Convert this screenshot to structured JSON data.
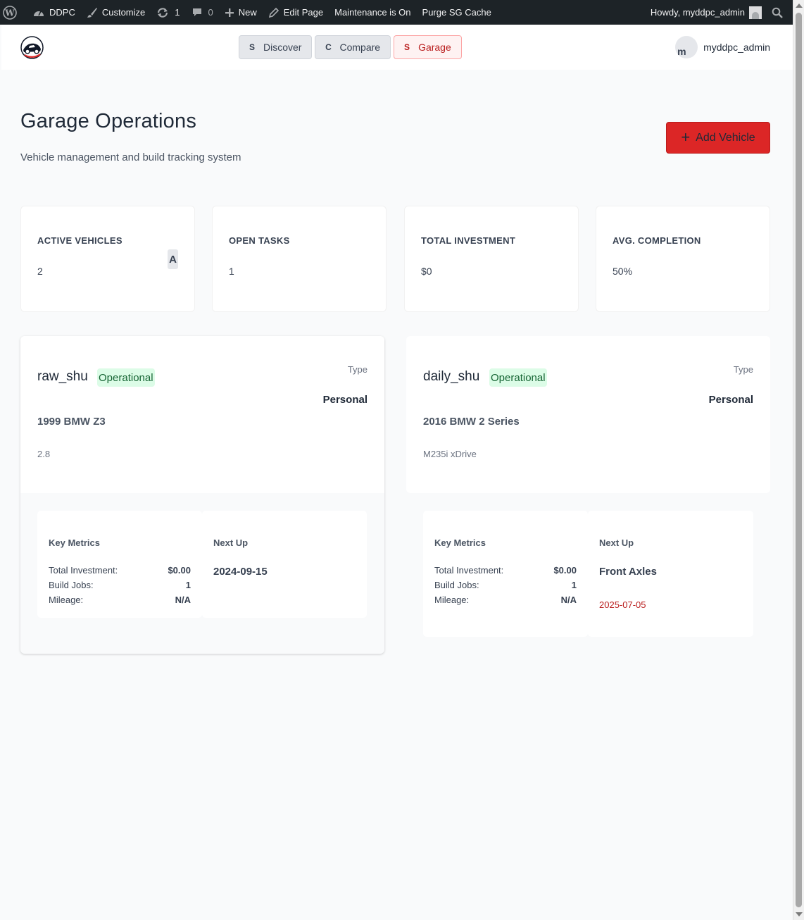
{
  "adminbar": {
    "site": "DDPC",
    "customize": "Customize",
    "updates_count": "1",
    "comments_count": "0",
    "new": "New",
    "edit_page": "Edit Page",
    "maintenance": "Maintenance is On",
    "purge": "Purge SG Cache",
    "howdy": "Howdy, myddpc_admin"
  },
  "nav": {
    "tabs": [
      {
        "badge": "S",
        "label": "Discover"
      },
      {
        "badge": "C",
        "label": "Compare"
      },
      {
        "badge": "S",
        "label": "Garage"
      }
    ],
    "user_initial": "m",
    "username": "myddpc_admin"
  },
  "page": {
    "title": "Garage Operations",
    "subtitle": "Vehicle management and build tracking system",
    "add_button": "Add Vehicle"
  },
  "stats": [
    {
      "label": "ACTIVE VEHICLES",
      "value": "2",
      "chip": "A"
    },
    {
      "label": "OPEN TASKS",
      "value": "1"
    },
    {
      "label": "TOTAL INVESTMENT",
      "value": "$0"
    },
    {
      "label": "AVG. COMPLETION",
      "value": "50%"
    }
  ],
  "vehicles": [
    {
      "name": "raw_shu",
      "status": "Operational",
      "type_label": "Type",
      "type": "Personal",
      "model": "1999 BMW Z3",
      "trim": "2.8",
      "metrics_title": "Key Metrics",
      "metrics": [
        {
          "label": "Total Investment:",
          "value": "$0.00"
        },
        {
          "label": "Build Jobs:",
          "value": "1"
        },
        {
          "label": "Mileage:",
          "value": "N/A"
        }
      ],
      "next_title": "Next Up",
      "next_item": "2024-09-15",
      "next_date": ""
    },
    {
      "name": "daily_shu",
      "status": "Operational",
      "type_label": "Type",
      "type": "Personal",
      "model": "2016 BMW 2 Series",
      "trim": "M235i xDrive",
      "metrics_title": "Key Metrics",
      "metrics": [
        {
          "label": "Total Investment:",
          "value": "$0.00"
        },
        {
          "label": "Build Jobs:",
          "value": "1"
        },
        {
          "label": "Mileage:",
          "value": "N/A"
        }
      ],
      "next_title": "Next Up",
      "next_item": "Front Axles",
      "next_date": "2025-07-05"
    }
  ],
  "colors": {
    "accent": "#dc2626",
    "status_bg": "#dcfce7",
    "status_text": "#166534",
    "adminbar": "#1d2327"
  }
}
